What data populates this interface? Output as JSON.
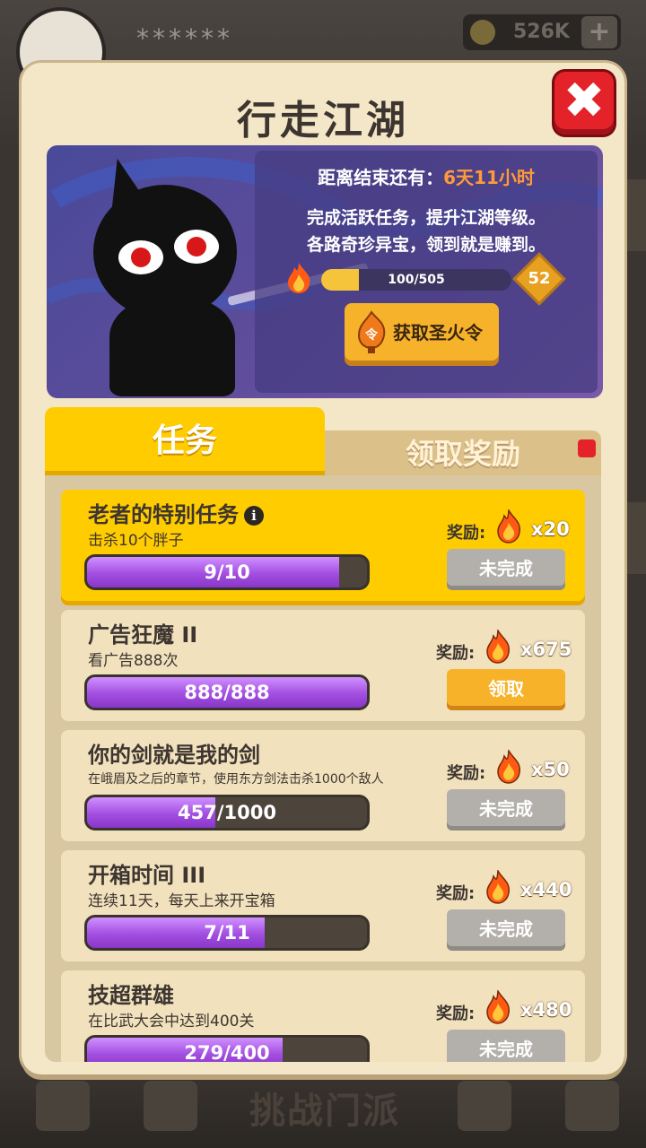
{
  "background": {
    "player_name": "******",
    "coins": "526K",
    "bottom_title": "挑战门派"
  },
  "panel": {
    "title": "行走江湖",
    "close_label": "✖"
  },
  "banner": {
    "countdown_prefix": "距离结束还有：",
    "countdown_value": "6天11小时",
    "desc_line1": "完成活跃任务，提升江湖等级。",
    "desc_line2": "各路奇珍异宝，领到就是赚到。",
    "level_progress_text": "100/505",
    "level_progress": 0.198,
    "level": "52",
    "fire_order_button": "获取圣火令",
    "fire_order_icon_char": "令"
  },
  "tabs": {
    "task": "任务",
    "reward": "领取奖励"
  },
  "tasks": [
    {
      "title": "老者的特别任务",
      "subtitle": "击杀10个胖子",
      "progress_text": "9/10",
      "progress": 0.9,
      "reward_label": "奖励:",
      "reward_count": "x20",
      "button": "未完成",
      "button_style": "grey"
    },
    {
      "title": "广告狂魔 II",
      "subtitle": "看广告888次",
      "progress_text": "888/888",
      "progress": 1.0,
      "reward_label": "奖励:",
      "reward_count": "x675",
      "button": "领取",
      "button_style": "orange"
    },
    {
      "title": "你的剑就是我的剑",
      "subtitle": "在峨眉及之后的章节，使用东方剑法击杀1000个敌人",
      "progress_text": "457/1000",
      "progress": 0.457,
      "reward_label": "奖励:",
      "reward_count": "x50",
      "button": "未完成",
      "button_style": "grey"
    },
    {
      "title": "开箱时间 III",
      "subtitle": "连续11天，每天上来开宝箱",
      "progress_text": "7/11",
      "progress": 0.636,
      "reward_label": "奖励:",
      "reward_count": "x440",
      "button": "未完成",
      "button_style": "grey"
    },
    {
      "title": "技超群雄",
      "subtitle": "在比武大会中达到400关",
      "progress_text": "279/400",
      "progress": 0.698,
      "reward_label": "奖励:",
      "reward_count": "x480",
      "button": "未完成",
      "button_style": "grey"
    }
  ],
  "colors": {
    "accent_yellow": "#ffcc00",
    "progress_purple": "#a24ee0",
    "close_red": "#e3222a",
    "countdown_orange": "#ff9a3a"
  },
  "icons": {
    "close": "close-icon",
    "flame": "flame-icon",
    "info": "info-icon",
    "level_badge": "level-badge-icon"
  }
}
